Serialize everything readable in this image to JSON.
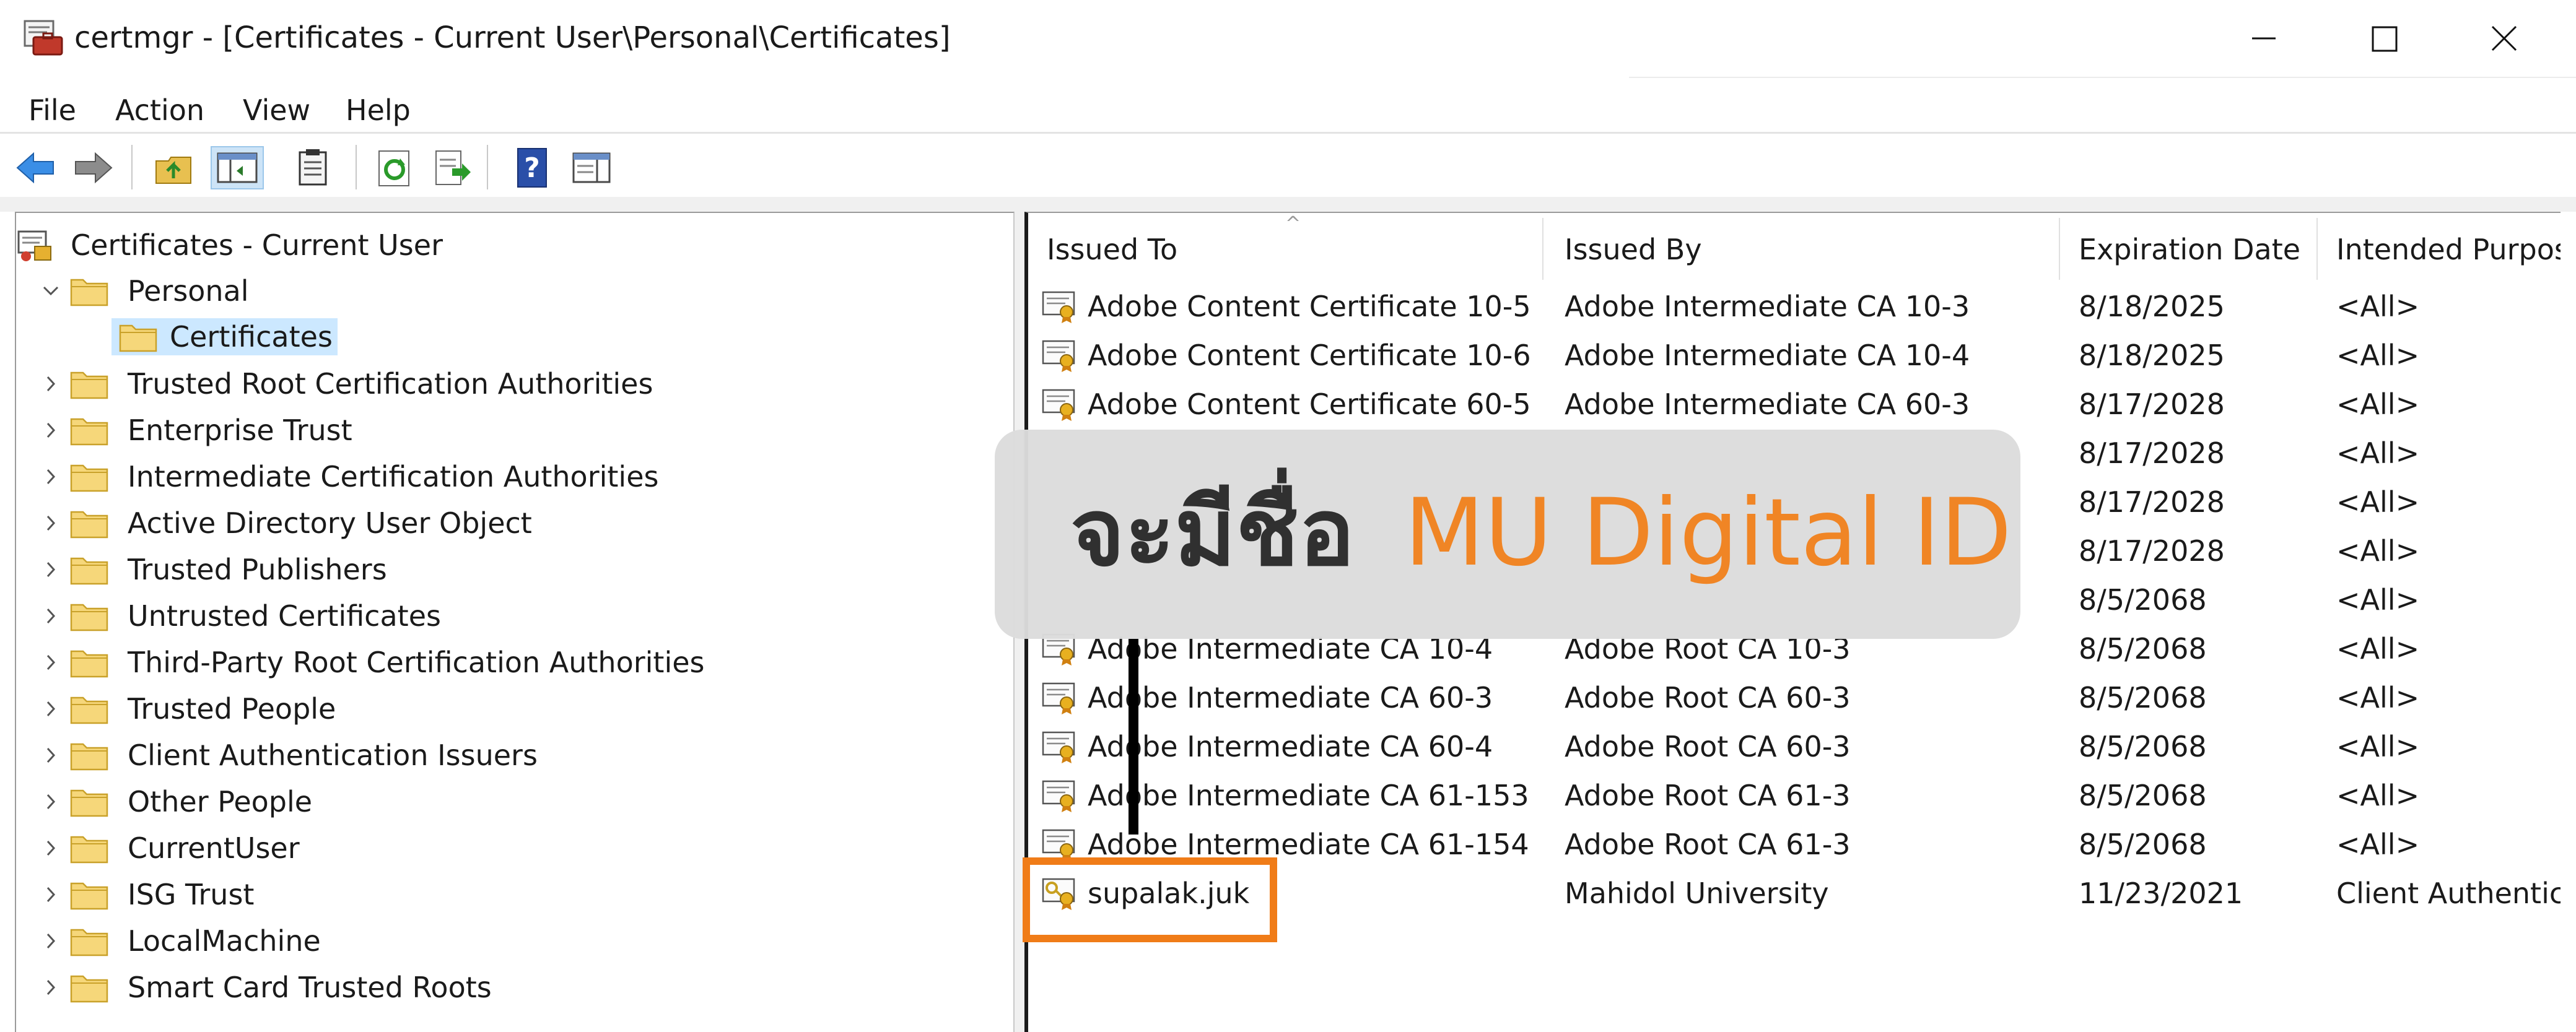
{
  "window": {
    "title": "certmgr - [Certificates - Current User\\Personal\\Certificates]",
    "controls": [
      "minimize",
      "maximize",
      "close"
    ]
  },
  "menu": [
    "File",
    "Action",
    "View",
    "Help"
  ],
  "toolbar": {
    "icons": [
      "back-arrow-icon",
      "forward-arrow-icon",
      "up-folder-icon",
      "show-hide-console-tree-icon",
      "clipboard-icon",
      "refresh-icon",
      "export-list-icon",
      "help-icon",
      "properties-pane-icon"
    ]
  },
  "tree": {
    "root": "Certificates - Current User",
    "personal": "Personal",
    "personal_child": "Certificates",
    "stores": [
      "Trusted Root Certification Authorities",
      "Enterprise Trust",
      "Intermediate Certification Authorities",
      "Active Directory User Object",
      "Trusted Publishers",
      "Untrusted Certificates",
      "Third-Party Root Certification Authorities",
      "Trusted People",
      "Client Authentication Issuers",
      "Other People",
      "CurrentUser",
      "ISG Trust",
      "LocalMachine",
      "Smart Card Trusted Roots"
    ]
  },
  "list": {
    "columns": [
      "Issued To",
      "Issued By",
      "Expiration Date",
      "Intended Purpose"
    ],
    "rows": [
      {
        "issued_to": "Adobe Content Certificate 10-5",
        "issued_by": "Adobe Intermediate CA 10-3",
        "expiration": "8/18/2025",
        "purpose": "<All>"
      },
      {
        "issued_to": "Adobe Content Certificate 10-6",
        "issued_by": "Adobe Intermediate CA 10-4",
        "expiration": "8/18/2025",
        "purpose": "<All>"
      },
      {
        "issued_to": "Adobe Content Certificate 60-5",
        "issued_by": "Adobe Intermediate CA 60-3",
        "expiration": "8/17/2028",
        "purpose": "<All>"
      },
      {
        "issued_to": "",
        "issued_by": "",
        "expiration": "8/17/2028",
        "purpose": "<All>"
      },
      {
        "issued_to": "",
        "issued_by": "",
        "expiration": "8/17/2028",
        "purpose": "<All>"
      },
      {
        "issued_to": "",
        "issued_by": "",
        "expiration": "8/17/2028",
        "purpose": "<All>"
      },
      {
        "issued_to": "",
        "issued_by": "",
        "expiration": "8/5/2068",
        "purpose": "<All>"
      },
      {
        "issued_to": "Adobe Intermediate CA 10-4",
        "issued_by": "Adobe Root CA 10-3",
        "expiration": "8/5/2068",
        "purpose": "<All>"
      },
      {
        "issued_to": "Adobe Intermediate CA 60-3",
        "issued_by": "Adobe Root CA 60-3",
        "expiration": "8/5/2068",
        "purpose": "<All>"
      },
      {
        "issued_to": "Adobe Intermediate CA 60-4",
        "issued_by": "Adobe Root CA 60-3",
        "expiration": "8/5/2068",
        "purpose": "<All>"
      },
      {
        "issued_to": "Adobe Intermediate CA 61-153",
        "issued_by": "Adobe Root CA 61-3",
        "expiration": "8/5/2068",
        "purpose": "<All>"
      },
      {
        "issued_to": "Adobe Intermediate CA 61-154",
        "issued_by": "Adobe Root CA 61-3",
        "expiration": "8/5/2068",
        "purpose": "<All>"
      },
      {
        "issued_to": "supalak.juk",
        "issued_by": "Mahidol University",
        "expiration": "11/23/2021",
        "purpose": "Client Authentica"
      }
    ]
  },
  "overlay": {
    "thai_text": "จะมีชื่อ",
    "brand_text": "MU Digital ID",
    "brand_color": "#f0821e",
    "highlight_color": "#f07c18"
  }
}
